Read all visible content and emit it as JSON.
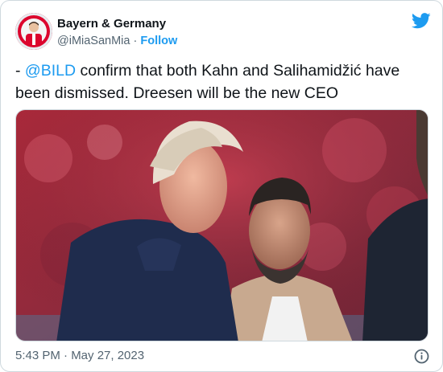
{
  "tweet": {
    "display_name": "Bayern & Germany",
    "handle": "@iMiaSanMia",
    "separator": "·",
    "follow_label": "Follow",
    "text_prefix": "- ",
    "mention": "@BILD",
    "text_body": " confirm that both Kahn and Salihamidžić have been dismissed. Dreesen will be the new CEO",
    "timestamp": "5:43 PM · May 27, 2023"
  },
  "colors": {
    "link": "#1d9bf0",
    "text": "#0f1419",
    "secondary": "#536471",
    "border": "#cfd9de"
  },
  "icons": {
    "brand": "twitter-bird-icon",
    "info": "info-icon"
  }
}
